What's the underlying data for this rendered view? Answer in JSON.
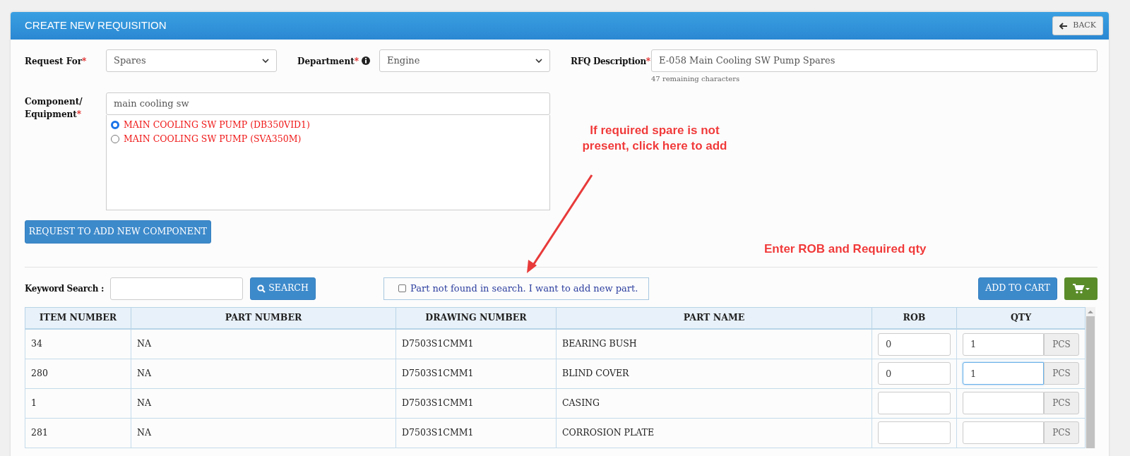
{
  "header": {
    "title": "CREATE NEW REQUISITION",
    "back_button": "BACK"
  },
  "request_for": {
    "label": "Request For",
    "mark": "*",
    "value": "Spares"
  },
  "department": {
    "label": "Department",
    "mark": "*",
    "value": "Engine"
  },
  "rfq_description": {
    "label": "RFQ Description",
    "mark": "*",
    "value": "E-058 Main Cooling SW Pump Spares",
    "hint": "47 remaining characters"
  },
  "component": {
    "label": "Component/ Equipment",
    "mark": "*",
    "value": "main cooling sw",
    "options": [
      {
        "label": "MAIN COOLING SW PUMP (DB350VID1)",
        "selected": true
      },
      {
        "label": "MAIN COOLING SW PUMP (SVA350M)",
        "selected": false
      }
    ]
  },
  "request_component_button": "REQUEST TO ADD NEW COMPONENT",
  "search": {
    "label": "Keyword Search :",
    "button": "SEARCH"
  },
  "new_part": {
    "label": "Part not found in search. I want to add new part.",
    "checked": false
  },
  "add_to_cart_button": "ADD TO CART",
  "table": {
    "columns": [
      "ITEM NUMBER",
      "PART NUMBER",
      "DRAWING NUMBER",
      "PART NAME",
      "ROB",
      "QTY"
    ],
    "rows": [
      {
        "item_number": "34",
        "part_number": "NA",
        "drawing_number": "D7503S1CMM1",
        "part_name": "BEARING BUSH",
        "rob": "0",
        "qty": "1",
        "unit": "PCS",
        "focused": false
      },
      {
        "item_number": "280",
        "part_number": "NA",
        "drawing_number": "D7503S1CMM1",
        "part_name": "BLIND COVER",
        "rob": "0",
        "qty": "1",
        "unit": "PCS",
        "focused": true
      },
      {
        "item_number": "1",
        "part_number": "NA",
        "drawing_number": "D7503S1CMM1",
        "part_name": "CASING",
        "rob": "",
        "qty": "",
        "unit": "PCS",
        "focused": false
      },
      {
        "item_number": "281",
        "part_number": "NA",
        "drawing_number": "D7503S1CMM1",
        "part_name": "CORROSION PLATE",
        "rob": "",
        "qty": "",
        "unit": "PCS",
        "focused": false
      }
    ]
  },
  "annotations": [
    {
      "kind": "callout_arrow",
      "text": "If required spare is not present, click here to add"
    },
    {
      "kind": "callout",
      "text": "Enter ROB and Required qty"
    }
  ]
}
